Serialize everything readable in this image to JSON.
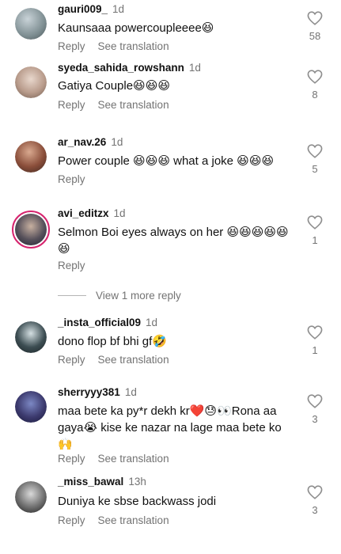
{
  "comments": [
    {
      "user": "gauri009_",
      "time": "1d",
      "text": "Kaunsaaa powercoupleeee😆",
      "reply": "Reply",
      "translate": "See translation",
      "likes": "58"
    },
    {
      "user": "syeda_sahida_rowshann",
      "time": "1d",
      "text": "Gatiya Couple😆😆😆",
      "reply": "Reply",
      "translate": "See translation",
      "likes": "8"
    },
    {
      "user": "ar_nav.26",
      "time": "1d",
      "text": "Power couple 😆😆😆 what a joke 😆😆😆",
      "reply": "Reply",
      "likes": "5"
    },
    {
      "user": "avi_editzx",
      "time": "1d",
      "text": "Selmon Boi eyes always on her 😆😆😆😆😆😆",
      "reply": "Reply",
      "likes": "1"
    },
    {
      "user": "_insta_official09",
      "time": "1d",
      "text": "dono flop bf  bhi gf🤣",
      "reply": "Reply",
      "translate": "See translation",
      "likes": "1"
    },
    {
      "user": "sherryyy381",
      "time": "1d",
      "text": "maa bete ka py*r dekh kr❤️😓👀Rona aa gaya😭 kise ke nazar na lage maa bete ko 🙌",
      "reply": "Reply",
      "translate": "See translation",
      "likes": "3"
    },
    {
      "user": "_miss_bawal",
      "time": "13h",
      "text": "Duniya ke sbse backwass jodi",
      "reply": "Reply",
      "translate": "See translation",
      "likes": "3"
    }
  ],
  "view_more": "View 1 more reply",
  "colors": {
    "heart_outline": "#8e8e8e",
    "meta_gray": "#737373",
    "story_ring": "#d6246e"
  },
  "icons": {
    "like": "heart-outline-icon"
  }
}
